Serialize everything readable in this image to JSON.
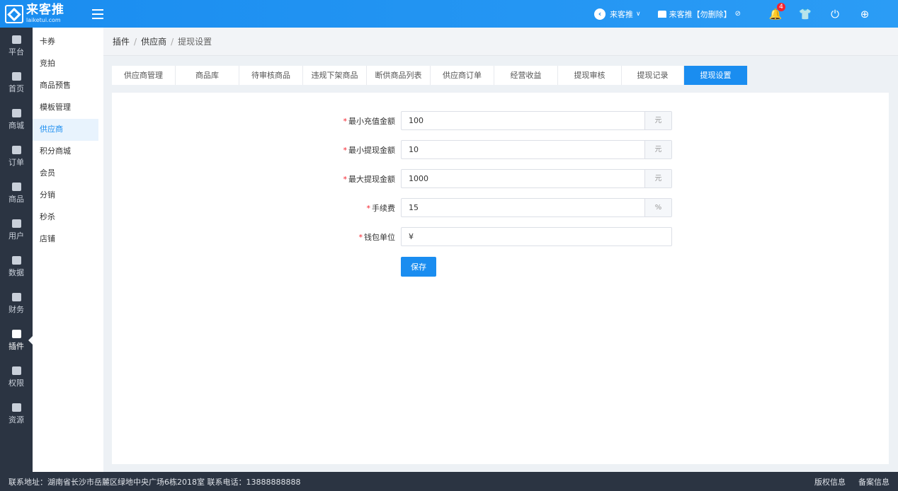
{
  "brand": {
    "name_cn": "来客推",
    "name_en": "laiketui.com"
  },
  "header": {
    "store_name": "来客推",
    "store_chevron": "∨",
    "shop_link": "来客推【勿删除】",
    "notification_count": "4",
    "icons": [
      "bell-icon",
      "shirt-icon",
      "power-icon",
      "globe-icon"
    ]
  },
  "leftnav": [
    {
      "label": "平台"
    },
    {
      "label": "首页"
    },
    {
      "label": "商城"
    },
    {
      "label": "订单"
    },
    {
      "label": "商品"
    },
    {
      "label": "用户"
    },
    {
      "label": "数据"
    },
    {
      "label": "财务"
    },
    {
      "label": "插件"
    },
    {
      "label": "权限"
    },
    {
      "label": "资源"
    }
  ],
  "leftnav_active": "插件",
  "submenu": [
    {
      "label": "卡券"
    },
    {
      "label": "竞拍"
    },
    {
      "label": "商品预售"
    },
    {
      "label": "模板管理"
    },
    {
      "label": "供应商"
    },
    {
      "label": "积分商城"
    },
    {
      "label": "会员"
    },
    {
      "label": "分销"
    },
    {
      "label": "秒杀"
    },
    {
      "label": "店铺"
    }
  ],
  "submenu_active": "供应商",
  "breadcrumb": [
    "插件",
    "供应商",
    "提现设置"
  ],
  "tabs": [
    {
      "label": "供应商管理"
    },
    {
      "label": "商品库"
    },
    {
      "label": "待审核商品"
    },
    {
      "label": "违规下架商品"
    },
    {
      "label": "断供商品列表"
    },
    {
      "label": "供应商订单"
    },
    {
      "label": "经营收益"
    },
    {
      "label": "提现审核"
    },
    {
      "label": "提现记录"
    },
    {
      "label": "提现设置"
    }
  ],
  "tab_active": "提现设置",
  "form": {
    "fields": [
      {
        "label": "最小充值金额",
        "value": "100",
        "unit": "元"
      },
      {
        "label": "最小提现金额",
        "value": "10",
        "unit": "元"
      },
      {
        "label": "最大提现金额",
        "value": "1000",
        "unit": "元"
      },
      {
        "label": "手续费",
        "value": "15",
        "unit": "%"
      },
      {
        "label": "钱包单位",
        "value": "¥",
        "unit": ""
      }
    ],
    "required_mark": "*",
    "save_label": "保存"
  },
  "footer": {
    "address": "联系地址：湖南省长沙市岳麓区绿地中央广场6栋2018室 联系电话：13888888888",
    "links": [
      "版权信息",
      "备案信息"
    ]
  },
  "colors": {
    "primary": "#1a8df0",
    "nav_bg": "#2b3442",
    "required": "#f5222d"
  }
}
